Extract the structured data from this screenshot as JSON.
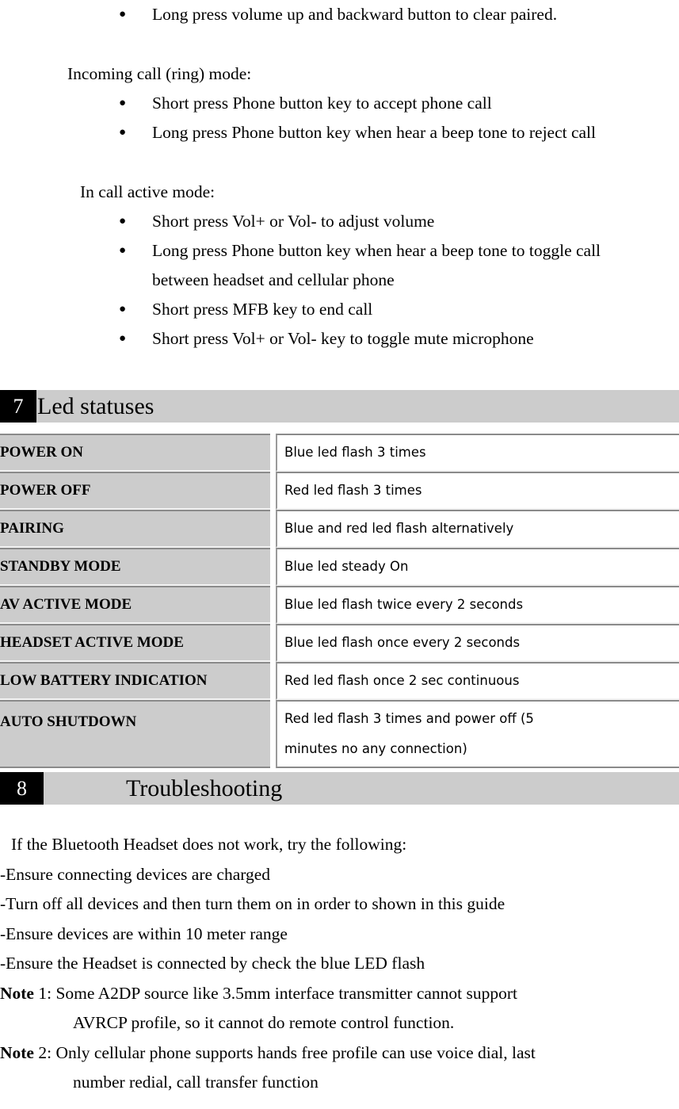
{
  "document": {
    "type": "bluetooth-headset-user-manual-page"
  },
  "top_section": {
    "first_bullet": "Long press volume up and backward button to clear paired.",
    "bullet_glyph": "●",
    "incoming_mode": {
      "label": "Incoming call (ring) mode:",
      "bullets": [
        "Short press Phone button key to accept phone call",
        "Long press Phone button key when hear a beep tone to reject call"
      ]
    },
    "in_call_mode": {
      "label": "In call active mode:",
      "bullets": [
        "Short press Vol+ or Vol- to adjust volume",
        "Long press Phone button key when hear a beep tone to toggle call",
        "Short press MFB key to end call",
        "Short press Vol+ or Vol- key to toggle mute microphone"
      ],
      "bullet2_continuation": "between headset and cellular phone"
    }
  },
  "section7": {
    "number": "7",
    "title": "Led statuses",
    "table": {
      "rows": [
        {
          "state": "POWER ON",
          "behavior": "Blue led flash 3 times"
        },
        {
          "state": "POWER OFF",
          "behavior": "Red led flash 3 times"
        },
        {
          "state": "PAIRING",
          "behavior": "Blue and red led flash alternatively"
        },
        {
          "state": "STANDBY MODE",
          "behavior": "Blue led steady On"
        },
        {
          "state": "AV ACTIVE MODE",
          "behavior": "Blue led flash twice every 2 seconds"
        },
        {
          "state": "HEADSET ACTIVE MODE",
          "behavior": "Blue led flash once every 2 seconds"
        },
        {
          "state": "LOW BATTERY INDICATION",
          "behavior": "Red led flash once 2 sec continuous"
        },
        {
          "state": "AUTO SHUTDOWN",
          "behavior": "Red led flash 3 times and power off (5 minutes no any connection)"
        }
      ]
    }
  },
  "section8": {
    "number": "8",
    "title": "Troubleshooting",
    "intro": "If the Bluetooth Headset does not work, try the following:",
    "checks": [
      "-Ensure connecting devices are charged",
      "-Turn off all devices and then turn them on in order to shown in this guide",
      "-Ensure devices are within 10 meter range",
      "-Ensure the Headset is connected by check the blue LED flash"
    ],
    "notes": [
      {
        "label": "Note",
        "rest": " 1: Some A2DP source like 3.5mm interface transmitter cannot support",
        "continuation": "AVRCP profile, so it cannot do remote control function."
      },
      {
        "label": "Note",
        "rest": " 2: Only cellular phone supports hands free profile can use voice dial, last",
        "continuation": "number redial, call transfer function"
      }
    ]
  },
  "colors": {
    "section_bar": "#cccccc",
    "section_badge": "#000000",
    "table_key_bg": "#cccccc",
    "table_border": "#8a8a8a"
  }
}
